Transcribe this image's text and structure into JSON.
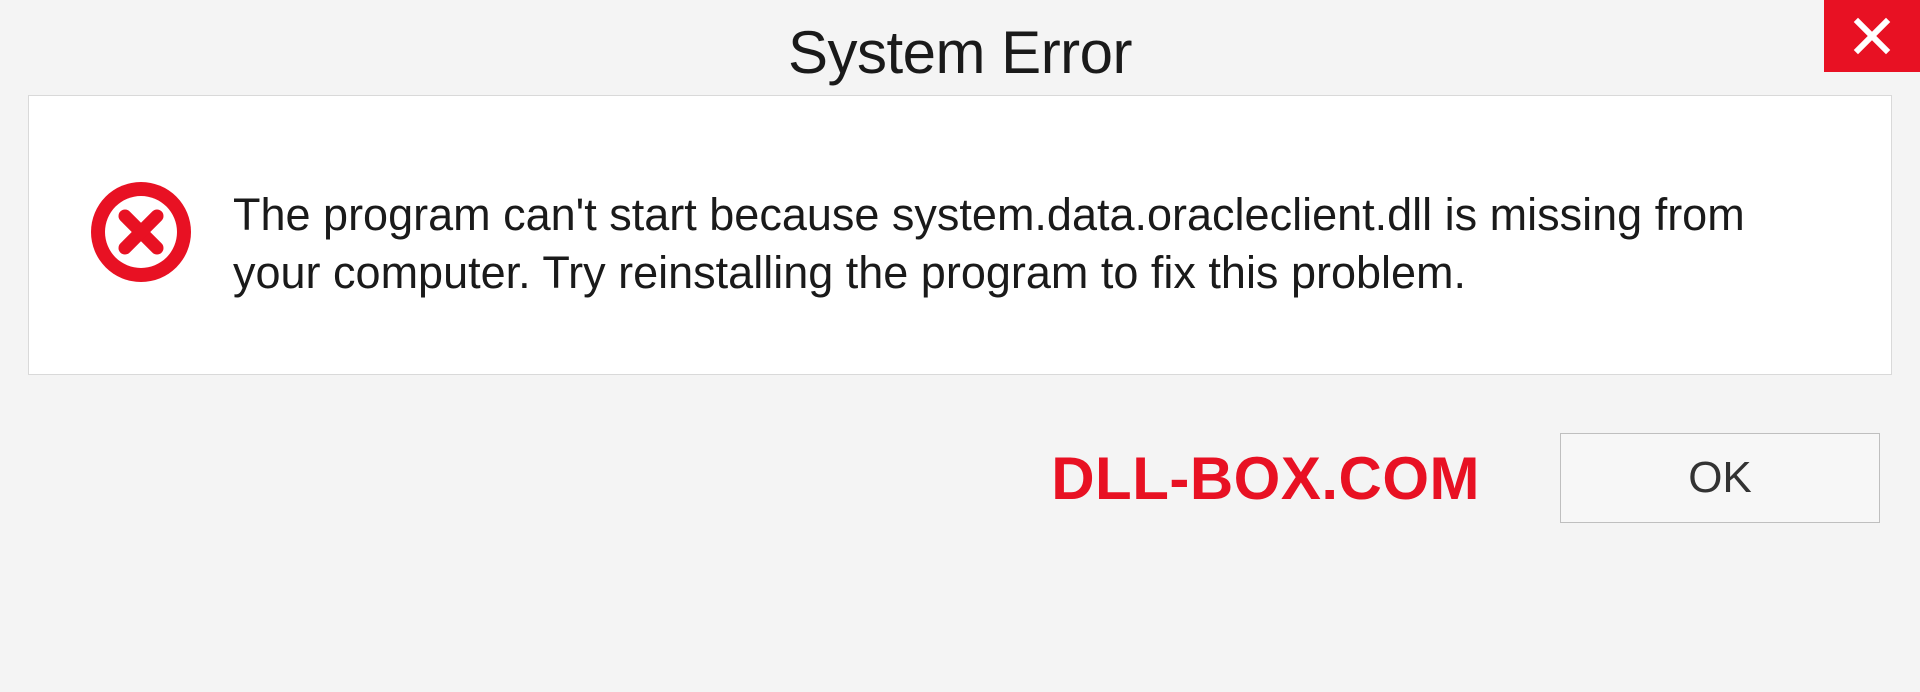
{
  "dialog": {
    "title": "System Error",
    "message": "The program can't start because system.data.oracleclient.dll is missing from your computer. Try reinstalling the program to fix this problem.",
    "ok_label": "OK"
  },
  "watermark": "DLL-BOX.COM",
  "colors": {
    "error_red": "#e81123",
    "bg_gray": "#f4f4f4",
    "white": "#ffffff"
  }
}
